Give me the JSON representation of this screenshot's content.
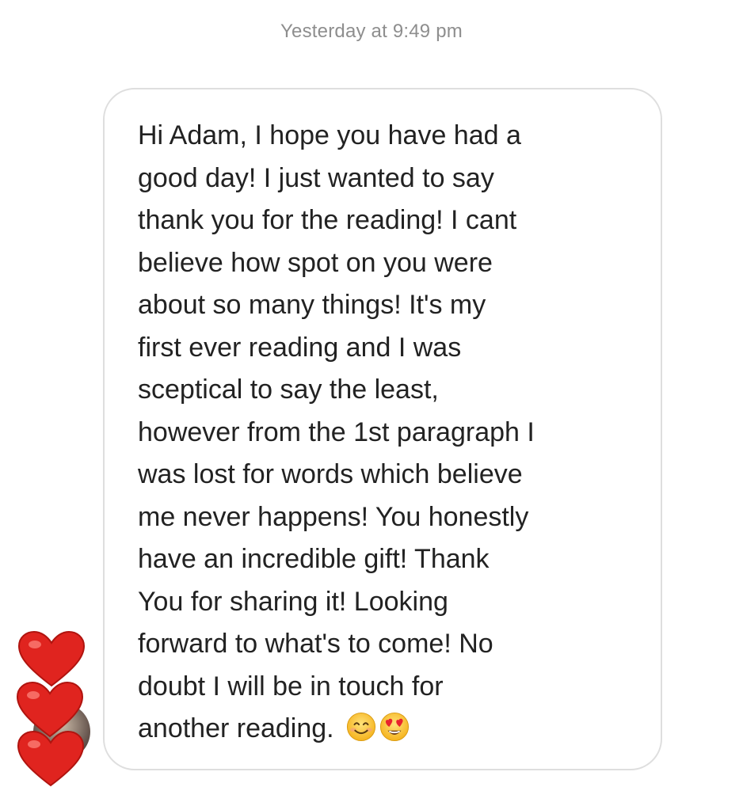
{
  "conversation": {
    "timestamp": "Yesterday at 9:49 pm",
    "message": {
      "lines": [
        "Hi Adam, I hope you have had a",
        "good day! I just wanted to say",
        "thank you for the reading! I cant",
        "believe how spot on you were",
        "about so many things! It's my",
        "first ever reading and I was",
        "sceptical to say the least,",
        "however from the 1st paragraph I",
        "was lost for words which believe",
        "me never happens! You honestly",
        "have an incredible gift! Thank",
        "You for sharing it! Looking",
        "forward to what's to come! No",
        "doubt I will be in touch for",
        "another reading."
      ],
      "emojis": [
        "smiling-face-icon",
        "heart-eyes-face-icon"
      ]
    },
    "sender": {
      "avatar": "avatar",
      "stickers": [
        "heart-icon",
        "heart-icon",
        "heart-icon"
      ]
    }
  },
  "colors": {
    "timestamp": "#8e8e8e",
    "text": "#222222",
    "bubble_border": "#dedede",
    "heart": "#e0241f",
    "emoji_yellow": "#f7c02b"
  }
}
